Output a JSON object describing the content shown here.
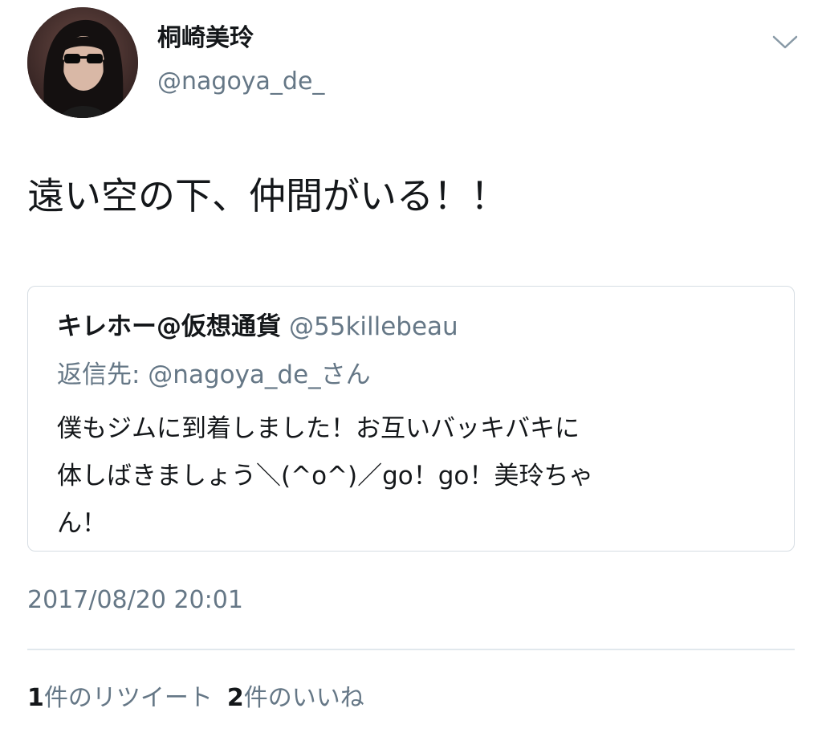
{
  "author": {
    "display_name": "桐崎美玲",
    "handle": "@nagoya_de_"
  },
  "icons": {
    "menu": "chevron-down-icon",
    "avatar": "avatar"
  },
  "tweet": {
    "text": "遠い空の下、仲間がいる！！",
    "timestamp": "2017/08/20 20:01"
  },
  "quoted_tweet": {
    "display_name": "キレホー@仮想通貨",
    "handle": "@55killebeau",
    "reply_to": "返信先: @nagoya_de_さん",
    "body_lines": [
      "僕もジムに到着しました！お互いバッキバキに",
      "体しばきましょう＼(^o^)／go！go！美玲ちゃ",
      "ん！"
    ]
  },
  "stats": {
    "retweets_count": "1",
    "retweets_label": "件のリツイート",
    "likes_count": "2",
    "likes_label": "件のいいね"
  },
  "colors": {
    "text_primary": "#14171a",
    "text_secondary": "#657786",
    "border": "#d6dde3",
    "divider": "#e1e8ed"
  }
}
